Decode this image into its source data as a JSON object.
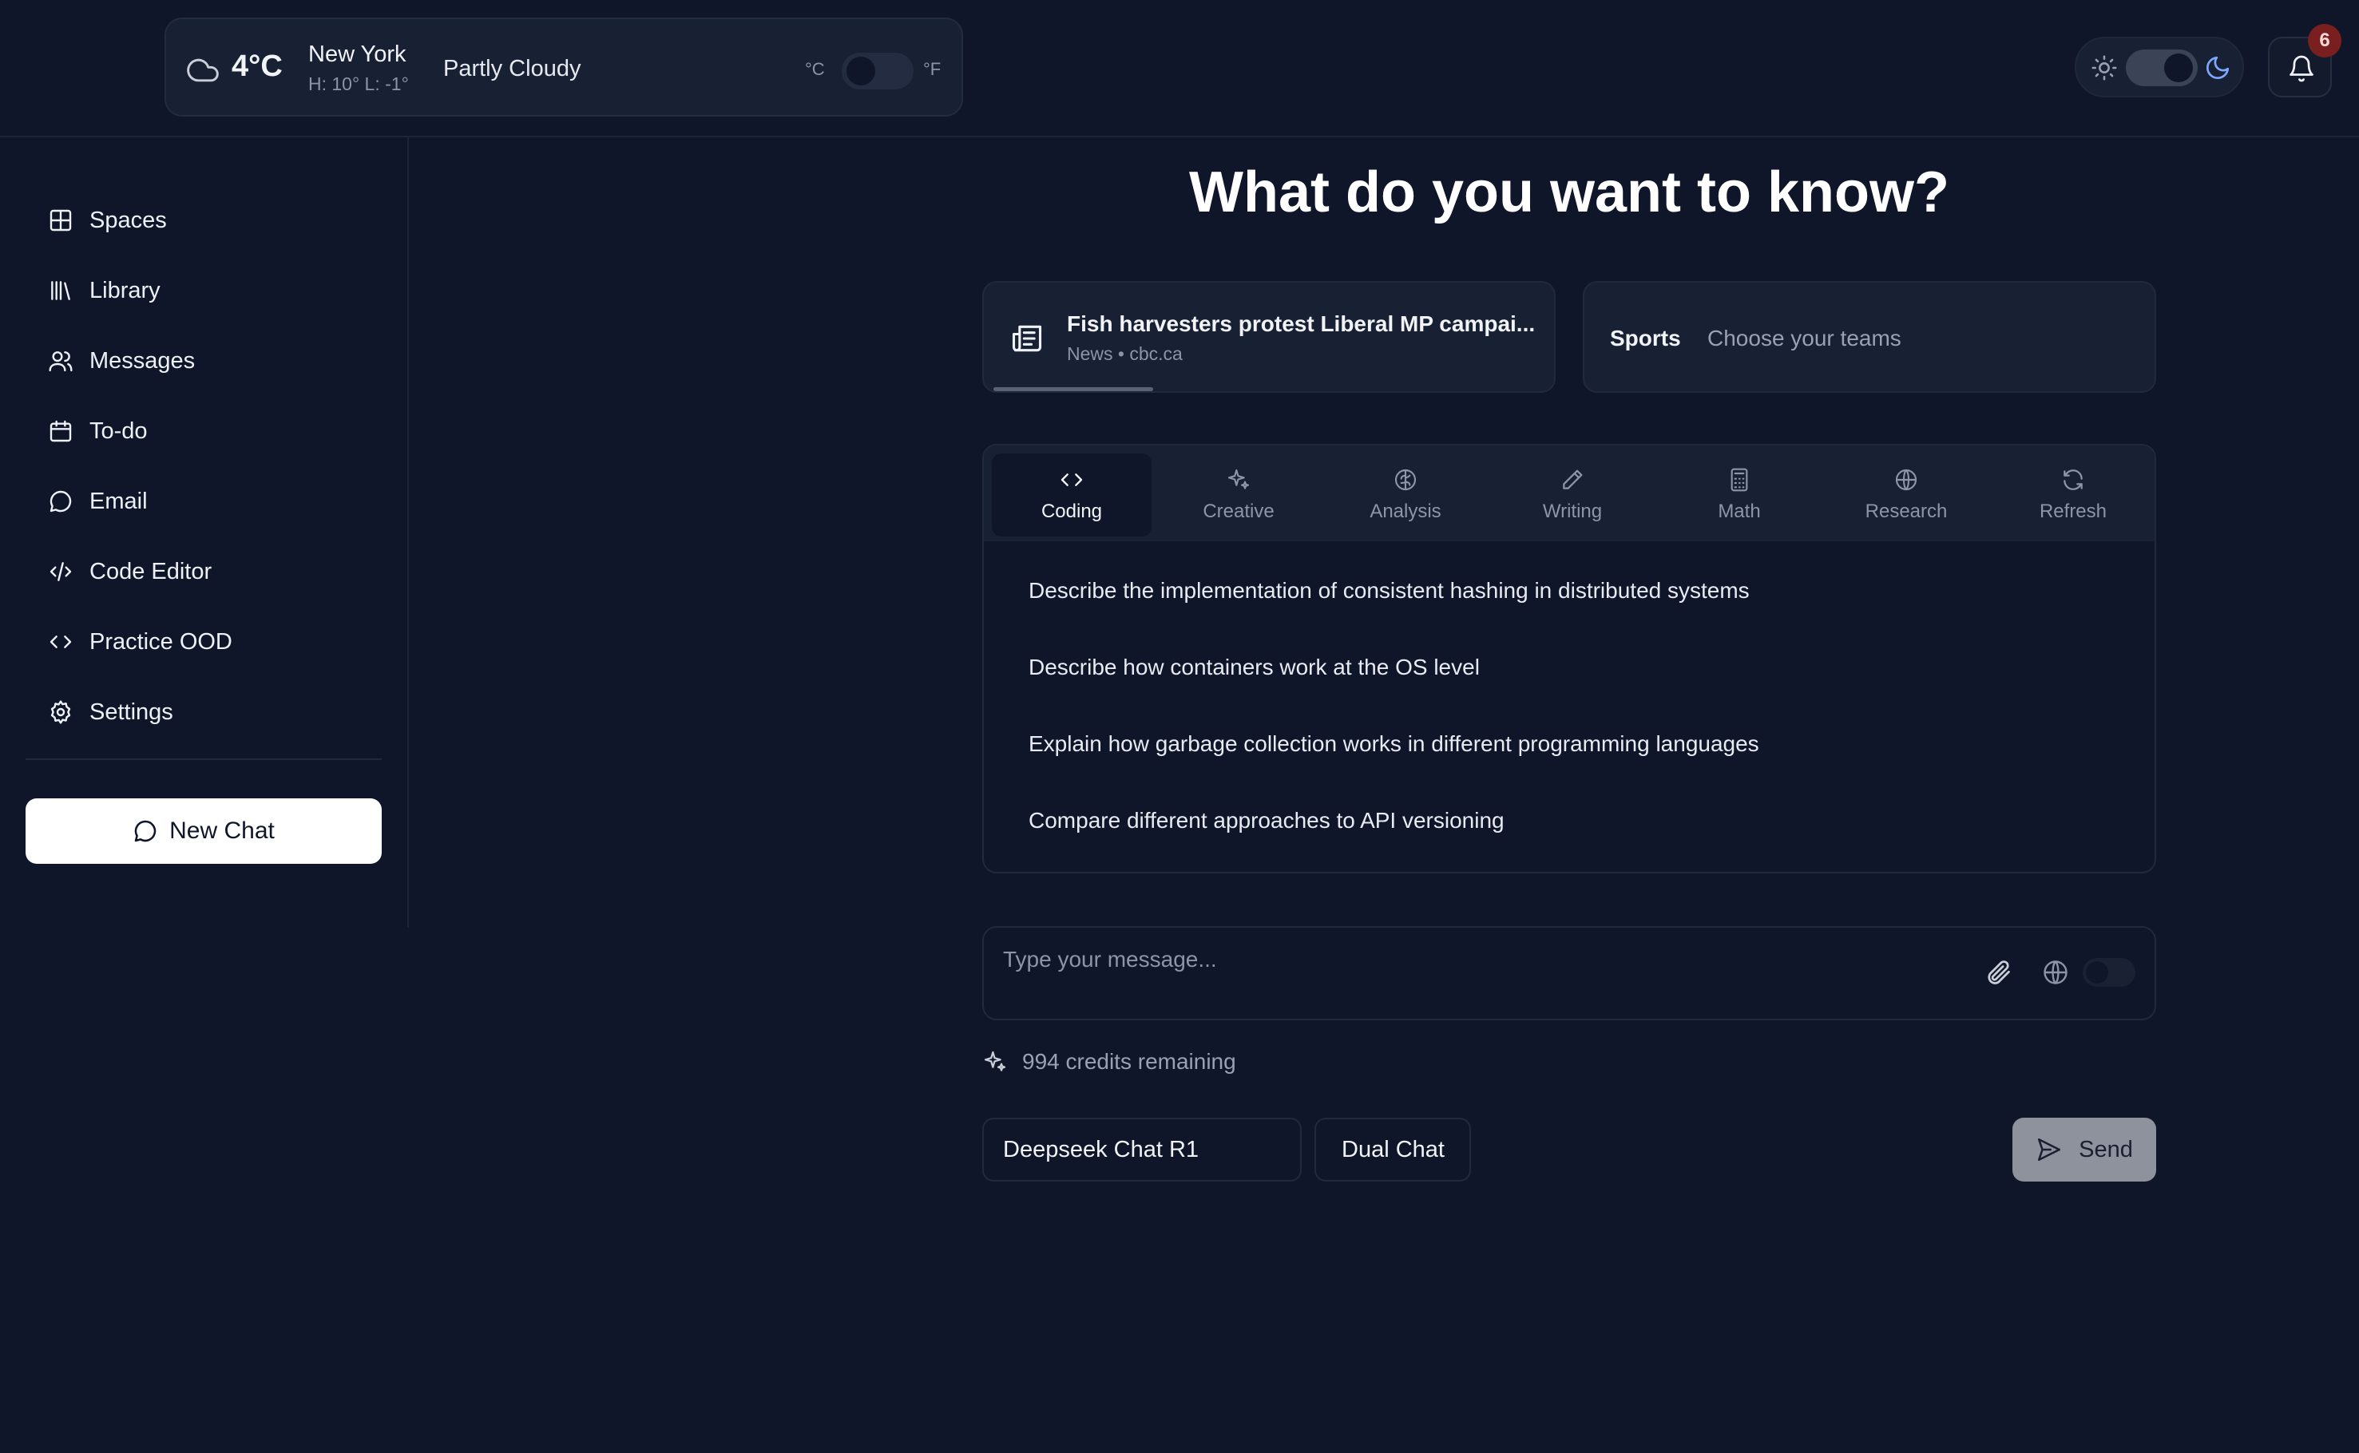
{
  "weather": {
    "temp": "4°C",
    "city": "New York",
    "hilo": "H: 10° L: -1°",
    "condition": "Partly Cloudy",
    "unit_c": "°C",
    "unit_f": "°F"
  },
  "notifications": {
    "count": "6"
  },
  "sidebar": {
    "items": [
      {
        "label": "Spaces",
        "icon": "grid-icon"
      },
      {
        "label": "Library",
        "icon": "library-icon"
      },
      {
        "label": "Messages",
        "icon": "users-icon"
      },
      {
        "label": "To-do",
        "icon": "calendar-icon"
      },
      {
        "label": "Email",
        "icon": "chat-bubble-icon"
      },
      {
        "label": "Code Editor",
        "icon": "code-slash-icon"
      },
      {
        "label": "Practice OOD",
        "icon": "code-brackets-icon"
      },
      {
        "label": "Settings",
        "icon": "gear-icon"
      }
    ],
    "new_chat": "New Chat"
  },
  "main": {
    "headline": "What do you want to know?",
    "news": {
      "title": "Fish harvesters protest Liberal MP campai...",
      "meta": "News • cbc.ca",
      "progress": 0.28
    },
    "sports": {
      "label": "Sports",
      "hint": "Choose your teams"
    },
    "tabs": [
      {
        "label": "Coding",
        "icon": "code-icon",
        "active": true
      },
      {
        "label": "Creative",
        "icon": "sparkles-icon",
        "active": false
      },
      {
        "label": "Analysis",
        "icon": "brain-icon",
        "active": false
      },
      {
        "label": "Writing",
        "icon": "pencil-icon",
        "active": false
      },
      {
        "label": "Math",
        "icon": "calculator-icon",
        "active": false
      },
      {
        "label": "Research",
        "icon": "globe-icon",
        "active": false
      },
      {
        "label": "Refresh",
        "icon": "refresh-icon",
        "active": false
      }
    ],
    "prompts": [
      "Describe the implementation of consistent hashing in distributed systems",
      "Describe how containers work at the OS level",
      "Explain how garbage collection works in different programming languages",
      "Compare different approaches to API versioning"
    ],
    "composer": {
      "placeholder": "Type your message..."
    },
    "credits": "994 credits remaining",
    "model": "Deepseek Chat R1",
    "dual": "Dual Chat",
    "send": "Send"
  },
  "colors": {
    "background": "#0f1629",
    "card": "#182034",
    "border": "#20293d",
    "send_button": "#8d929c",
    "badge": "#7a1f1f"
  }
}
